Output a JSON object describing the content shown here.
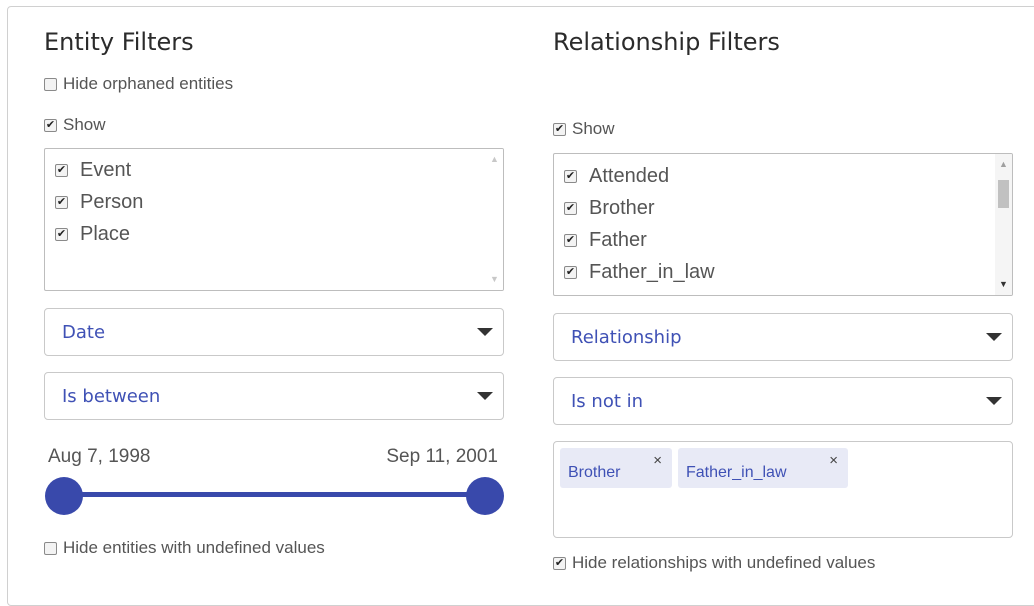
{
  "entity": {
    "title": "Entity Filters",
    "hide_orphaned_label": "Hide orphaned entities",
    "show_label": "Show",
    "types": [
      {
        "label": "Event",
        "checked": true
      },
      {
        "label": "Person",
        "checked": true
      },
      {
        "label": "Place",
        "checked": true
      }
    ],
    "property_select": "Date",
    "operator_select": "Is between",
    "range": {
      "start": "Aug 7, 1998",
      "end": "Sep 11, 2001"
    },
    "hide_undefined_label": "Hide entities with undefined values"
  },
  "relationship": {
    "title": "Relationship Filters",
    "show_label": "Show",
    "types": [
      {
        "label": "Attended",
        "checked": true
      },
      {
        "label": "Brother",
        "checked": true
      },
      {
        "label": "Father",
        "checked": true
      },
      {
        "label": "Father_in_law",
        "checked": true
      }
    ],
    "property_select": "Relationship",
    "operator_select": "Is not in",
    "tags": [
      {
        "label": "Brother",
        "remove": "×"
      },
      {
        "label": "Father_in_law",
        "remove": "×"
      }
    ],
    "hide_undefined_label": "Hide relationships with undefined values"
  },
  "checkmark": "✔",
  "colors": {
    "accent": "#3949ab",
    "select_text": "#3f51b5",
    "tag_bg": "#e8eaf6"
  }
}
